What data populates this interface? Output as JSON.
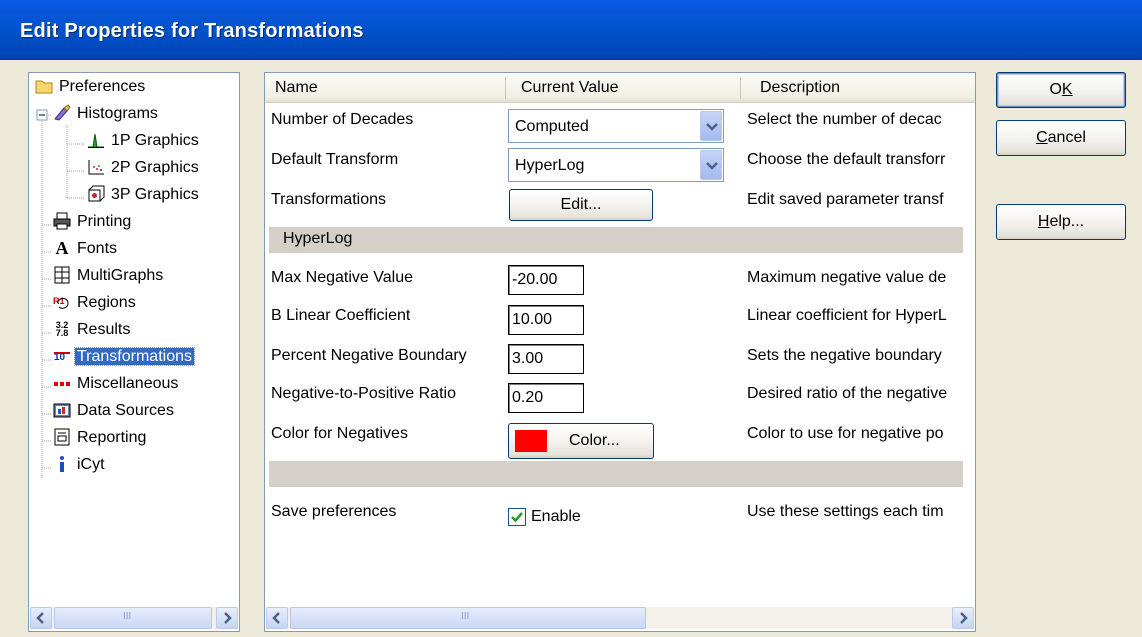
{
  "window": {
    "title": "Edit Properties for Transformations"
  },
  "tree": {
    "items": [
      {
        "label": "Preferences",
        "icon": "folder-icon"
      },
      {
        "label": "Histograms",
        "icon": "histogram-icon"
      },
      {
        "label": "1P Graphics",
        "icon": "1p-graph-icon"
      },
      {
        "label": "2P Graphics",
        "icon": "2p-graph-icon"
      },
      {
        "label": "3P Graphics",
        "icon": "3p-graph-icon"
      },
      {
        "label": "Printing",
        "icon": "printer-icon"
      },
      {
        "label": "Fonts",
        "icon": "font-icon"
      },
      {
        "label": "MultiGraphs",
        "icon": "multigraph-icon"
      },
      {
        "label": "Regions",
        "icon": "regions-icon"
      },
      {
        "label": "Results",
        "icon": "results-icon"
      },
      {
        "label": "Transformations",
        "icon": "transform-icon"
      },
      {
        "label": "Miscellaneous",
        "icon": "misc-icon"
      },
      {
        "label": "Data Sources",
        "icon": "data-source-icon"
      },
      {
        "label": "Reporting",
        "icon": "report-icon"
      },
      {
        "label": "iCyt",
        "icon": "info-icon"
      }
    ],
    "expander": "−",
    "results_icon_text": "3.2\n7.8",
    "transform_icon_text": "10",
    "font_icon_text": "A",
    "regions_icon_text": "R1"
  },
  "grid": {
    "headers": {
      "name": "Name",
      "value": "Current Value",
      "description": "Description"
    },
    "rows": {
      "decades": {
        "name": "Number of Decades",
        "value": "Computed",
        "description": "Select the number of decac"
      },
      "default_transform": {
        "name": "Default Transform",
        "value": "HyperLog",
        "description": "Choose the default transforr"
      },
      "transformations": {
        "name": "Transformations",
        "button": "Edit...",
        "description": "Edit saved parameter transf"
      },
      "section_hyperlog": "HyperLog",
      "max_negative": {
        "name": "Max Negative Value",
        "value": "-20.00",
        "description": "Maximum negative value de"
      },
      "b_linear": {
        "name": "B Linear Coefficient",
        "value": "10.00",
        "description": "Linear coefficient for HyperL"
      },
      "percent_negative": {
        "name": "Percent Negative Boundary",
        "value": "3.00",
        "description": "Sets the negative boundary"
      },
      "neg_pos_ratio": {
        "name": "Negative-to-Positive Ratio",
        "value": "0.20",
        "description": "Desired ratio of the negative"
      },
      "color_negatives": {
        "name": "Color for Negatives",
        "button": "Color...",
        "swatch": "#ff0000",
        "description": "Color to use for negative po"
      },
      "save_prefs": {
        "name": "Save preferences",
        "checkbox_label": "Enable",
        "checked": true,
        "description": "Use these settings each tim"
      }
    }
  },
  "buttons": {
    "ok": {
      "pre": "O",
      "u": "K",
      "post": ""
    },
    "cancel": {
      "pre": "",
      "u": "C",
      "post": "ancel"
    },
    "help": {
      "pre": "",
      "u": "H",
      "post": "elp..."
    }
  },
  "scroll": {
    "thumb_grip": "III"
  },
  "colors": {
    "title_bar": "#0052cc",
    "selection": "#316ac5",
    "swatch": "#ff0000"
  }
}
